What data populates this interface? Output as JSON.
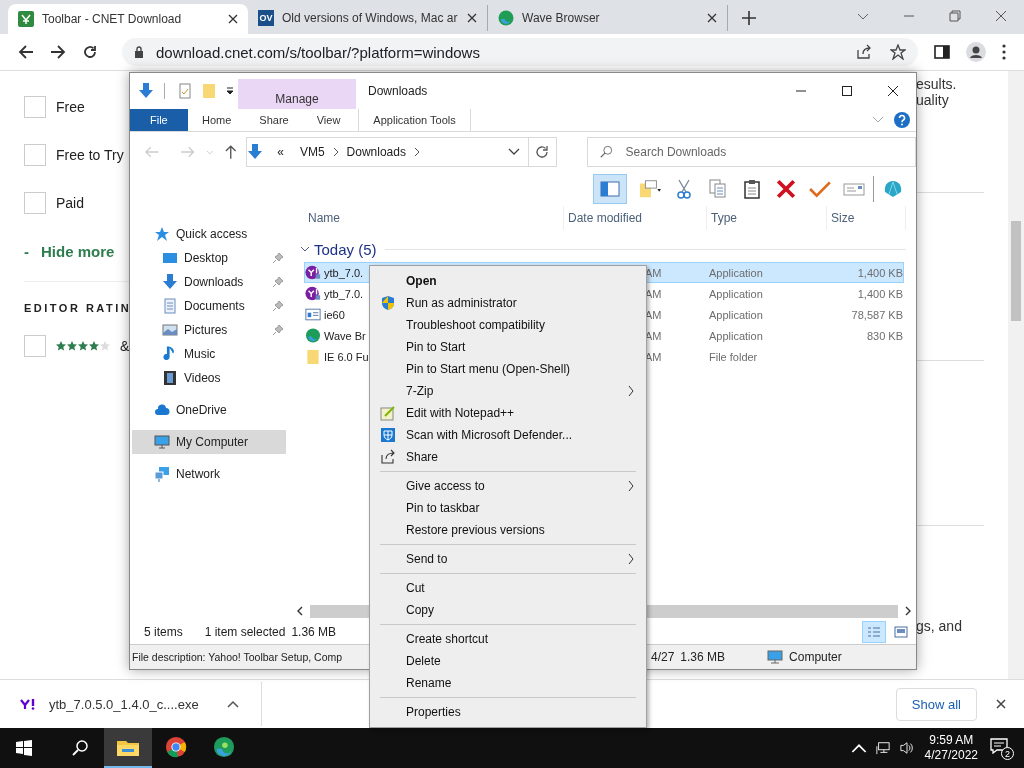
{
  "browser": {
    "tabs": [
      {
        "title": "Toolbar - CNET Download",
        "selected": true
      },
      {
        "title": "Old versions of Windows, Mac ar",
        "selected": false,
        "favicon_text": "OV"
      },
      {
        "title": "Wave Browser",
        "selected": false
      }
    ],
    "url": "download.cnet.com/s/toolbar/?platform=windows"
  },
  "web_page": {
    "filters": [
      {
        "label": "Free",
        "checked": false
      },
      {
        "label": "Free to Try",
        "checked": false
      },
      {
        "label": "Paid",
        "checked": false
      }
    ],
    "hide_more_sign": "-",
    "hide_more": "Hide more",
    "editor_rating": {
      "heading": "EDITOR RATIN",
      "checked": false,
      "stars": 4,
      "suffix": "&"
    },
    "right_texts": [
      "esults.",
      "uality",
      "gs, and"
    ]
  },
  "explorer": {
    "title": "Downloads",
    "contextual_group": "Manage",
    "ribbon_tabs": [
      {
        "label": "File",
        "kind": "file"
      },
      {
        "label": "Home",
        "kind": "tab"
      },
      {
        "label": "Share",
        "kind": "tab"
      },
      {
        "label": "View",
        "kind": "tab"
      },
      {
        "label": "Application Tools",
        "kind": "contextual"
      }
    ],
    "breadcrumb": [
      "«",
      "VM5",
      "Downloads"
    ],
    "search_placeholder": "Search Downloads",
    "nav": [
      {
        "label": "Quick access",
        "selected": false,
        "children": [
          {
            "label": "Desktop",
            "pinned": true,
            "selected": false
          },
          {
            "label": "Downloads",
            "pinned": true,
            "selected": false
          },
          {
            "label": "Documents",
            "pinned": true,
            "selected": false
          },
          {
            "label": "Pictures",
            "pinned": true,
            "selected": false
          },
          {
            "label": "Music",
            "pinned": false,
            "selected": false
          },
          {
            "label": "Videos",
            "pinned": false,
            "selected": false
          }
        ]
      },
      {
        "label": "OneDrive",
        "selected": false
      },
      {
        "label": "My Computer",
        "selected": true
      },
      {
        "label": "Network",
        "selected": false
      }
    ],
    "columns": [
      "Name",
      "Date modified",
      "Type",
      "Size"
    ],
    "group": {
      "label": "Today (5)",
      "expanded": true
    },
    "files": [
      {
        "name": "ytb_7.0.",
        "date": "AM",
        "type": "Application",
        "size": "1,400 KB",
        "selected": true
      },
      {
        "name": "ytb_7.0.",
        "date": "AM",
        "type": "Application",
        "size": "1,400 KB",
        "selected": false
      },
      {
        "name": "ie60",
        "date": "AM",
        "type": "Application",
        "size": "78,587 KB",
        "selected": false
      },
      {
        "name": "Wave Br",
        "date": "AM",
        "type": "Application",
        "size": "830 KB",
        "selected": false
      },
      {
        "name": "IE 6.0 Fu",
        "date": "AM",
        "type": "File folder",
        "selected": false
      }
    ],
    "item_count": "5 items",
    "selection": "1 item selected",
    "selection_size": "1.36 MB",
    "description": "File description: Yahoo! Toolbar Setup, Comp",
    "desc_date": "4/27",
    "desc_size": "1.36 MB",
    "location": "Computer"
  },
  "context_menu": {
    "items": [
      {
        "kind": "item",
        "label": "Open",
        "default": true,
        "submenu": false
      },
      {
        "kind": "item",
        "label": "Run as administrator",
        "default": false,
        "submenu": false
      },
      {
        "kind": "item",
        "label": "Troubleshoot compatibility",
        "default": false,
        "submenu": false
      },
      {
        "kind": "item",
        "label": "Pin to Start",
        "default": false,
        "submenu": false
      },
      {
        "kind": "item",
        "label": "Pin to Start menu (Open-Shell)",
        "default": false,
        "submenu": false
      },
      {
        "kind": "item",
        "label": "7-Zip",
        "default": false,
        "submenu": true
      },
      {
        "kind": "item",
        "label": "Edit with Notepad++",
        "default": false,
        "submenu": false
      },
      {
        "kind": "item",
        "label": "Scan with Microsoft Defender...",
        "default": false,
        "submenu": false
      },
      {
        "kind": "item",
        "label": "Share",
        "default": false,
        "submenu": false
      },
      {
        "kind": "separator"
      },
      {
        "kind": "item",
        "label": "Give access to",
        "default": false,
        "submenu": true
      },
      {
        "kind": "item",
        "label": "Pin to taskbar",
        "default": false,
        "submenu": false
      },
      {
        "kind": "item",
        "label": "Restore previous versions",
        "default": false,
        "submenu": false
      },
      {
        "kind": "separator"
      },
      {
        "kind": "item",
        "label": "Send to",
        "default": false,
        "submenu": true
      },
      {
        "kind": "separator"
      },
      {
        "kind": "item",
        "label": "Cut",
        "default": false,
        "submenu": false
      },
      {
        "kind": "item",
        "label": "Copy",
        "default": false,
        "submenu": false
      },
      {
        "kind": "separator"
      },
      {
        "kind": "item",
        "label": "Create shortcut",
        "default": false,
        "submenu": false
      },
      {
        "kind": "item",
        "label": "Delete",
        "default": false,
        "submenu": false
      },
      {
        "kind": "item",
        "label": "Rename",
        "default": false,
        "submenu": false
      },
      {
        "kind": "separator"
      },
      {
        "kind": "item",
        "label": "Properties",
        "default": false,
        "submenu": false
      }
    ]
  },
  "download_shelf": {
    "file": "ytb_7.0.5.0_1.4.0_c....exe",
    "show_all": "Show all"
  },
  "taskbar": {
    "apps": [
      {
        "active": true
      },
      {
        "active": false
      },
      {
        "active": false
      }
    ],
    "time": "9:59 AM",
    "date": "4/27/2022",
    "notifications": "2"
  }
}
